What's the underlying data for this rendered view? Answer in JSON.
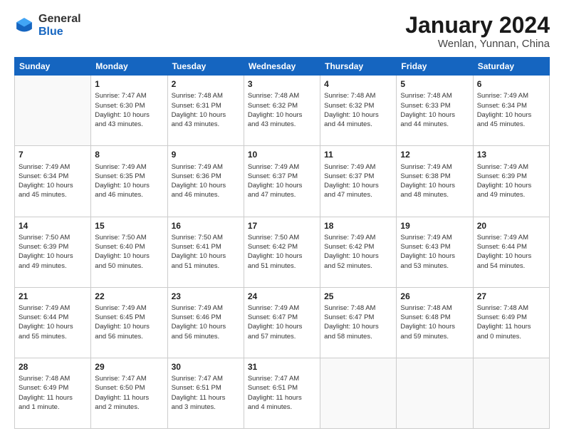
{
  "header": {
    "logo_general": "General",
    "logo_blue": "Blue",
    "title": "January 2024",
    "subtitle": "Wenlan, Yunnan, China"
  },
  "weekdays": [
    "Sunday",
    "Monday",
    "Tuesday",
    "Wednesday",
    "Thursday",
    "Friday",
    "Saturday"
  ],
  "weeks": [
    [
      {
        "day": "",
        "info": ""
      },
      {
        "day": "1",
        "info": "Sunrise: 7:47 AM\nSunset: 6:30 PM\nDaylight: 10 hours\nand 43 minutes."
      },
      {
        "day": "2",
        "info": "Sunrise: 7:48 AM\nSunset: 6:31 PM\nDaylight: 10 hours\nand 43 minutes."
      },
      {
        "day": "3",
        "info": "Sunrise: 7:48 AM\nSunset: 6:32 PM\nDaylight: 10 hours\nand 43 minutes."
      },
      {
        "day": "4",
        "info": "Sunrise: 7:48 AM\nSunset: 6:32 PM\nDaylight: 10 hours\nand 44 minutes."
      },
      {
        "day": "5",
        "info": "Sunrise: 7:48 AM\nSunset: 6:33 PM\nDaylight: 10 hours\nand 44 minutes."
      },
      {
        "day": "6",
        "info": "Sunrise: 7:49 AM\nSunset: 6:34 PM\nDaylight: 10 hours\nand 45 minutes."
      }
    ],
    [
      {
        "day": "7",
        "info": "Sunrise: 7:49 AM\nSunset: 6:34 PM\nDaylight: 10 hours\nand 45 minutes."
      },
      {
        "day": "8",
        "info": "Sunrise: 7:49 AM\nSunset: 6:35 PM\nDaylight: 10 hours\nand 46 minutes."
      },
      {
        "day": "9",
        "info": "Sunrise: 7:49 AM\nSunset: 6:36 PM\nDaylight: 10 hours\nand 46 minutes."
      },
      {
        "day": "10",
        "info": "Sunrise: 7:49 AM\nSunset: 6:37 PM\nDaylight: 10 hours\nand 47 minutes."
      },
      {
        "day": "11",
        "info": "Sunrise: 7:49 AM\nSunset: 6:37 PM\nDaylight: 10 hours\nand 47 minutes."
      },
      {
        "day": "12",
        "info": "Sunrise: 7:49 AM\nSunset: 6:38 PM\nDaylight: 10 hours\nand 48 minutes."
      },
      {
        "day": "13",
        "info": "Sunrise: 7:49 AM\nSunset: 6:39 PM\nDaylight: 10 hours\nand 49 minutes."
      }
    ],
    [
      {
        "day": "14",
        "info": "Sunrise: 7:50 AM\nSunset: 6:39 PM\nDaylight: 10 hours\nand 49 minutes."
      },
      {
        "day": "15",
        "info": "Sunrise: 7:50 AM\nSunset: 6:40 PM\nDaylight: 10 hours\nand 50 minutes."
      },
      {
        "day": "16",
        "info": "Sunrise: 7:50 AM\nSunset: 6:41 PM\nDaylight: 10 hours\nand 51 minutes."
      },
      {
        "day": "17",
        "info": "Sunrise: 7:50 AM\nSunset: 6:42 PM\nDaylight: 10 hours\nand 51 minutes."
      },
      {
        "day": "18",
        "info": "Sunrise: 7:49 AM\nSunset: 6:42 PM\nDaylight: 10 hours\nand 52 minutes."
      },
      {
        "day": "19",
        "info": "Sunrise: 7:49 AM\nSunset: 6:43 PM\nDaylight: 10 hours\nand 53 minutes."
      },
      {
        "day": "20",
        "info": "Sunrise: 7:49 AM\nSunset: 6:44 PM\nDaylight: 10 hours\nand 54 minutes."
      }
    ],
    [
      {
        "day": "21",
        "info": "Sunrise: 7:49 AM\nSunset: 6:44 PM\nDaylight: 10 hours\nand 55 minutes."
      },
      {
        "day": "22",
        "info": "Sunrise: 7:49 AM\nSunset: 6:45 PM\nDaylight: 10 hours\nand 56 minutes."
      },
      {
        "day": "23",
        "info": "Sunrise: 7:49 AM\nSunset: 6:46 PM\nDaylight: 10 hours\nand 56 minutes."
      },
      {
        "day": "24",
        "info": "Sunrise: 7:49 AM\nSunset: 6:47 PM\nDaylight: 10 hours\nand 57 minutes."
      },
      {
        "day": "25",
        "info": "Sunrise: 7:48 AM\nSunset: 6:47 PM\nDaylight: 10 hours\nand 58 minutes."
      },
      {
        "day": "26",
        "info": "Sunrise: 7:48 AM\nSunset: 6:48 PM\nDaylight: 10 hours\nand 59 minutes."
      },
      {
        "day": "27",
        "info": "Sunrise: 7:48 AM\nSunset: 6:49 PM\nDaylight: 11 hours\nand 0 minutes."
      }
    ],
    [
      {
        "day": "28",
        "info": "Sunrise: 7:48 AM\nSunset: 6:49 PM\nDaylight: 11 hours\nand 1 minute."
      },
      {
        "day": "29",
        "info": "Sunrise: 7:47 AM\nSunset: 6:50 PM\nDaylight: 11 hours\nand 2 minutes."
      },
      {
        "day": "30",
        "info": "Sunrise: 7:47 AM\nSunset: 6:51 PM\nDaylight: 11 hours\nand 3 minutes."
      },
      {
        "day": "31",
        "info": "Sunrise: 7:47 AM\nSunset: 6:51 PM\nDaylight: 11 hours\nand 4 minutes."
      },
      {
        "day": "",
        "info": ""
      },
      {
        "day": "",
        "info": ""
      },
      {
        "day": "",
        "info": ""
      }
    ]
  ]
}
